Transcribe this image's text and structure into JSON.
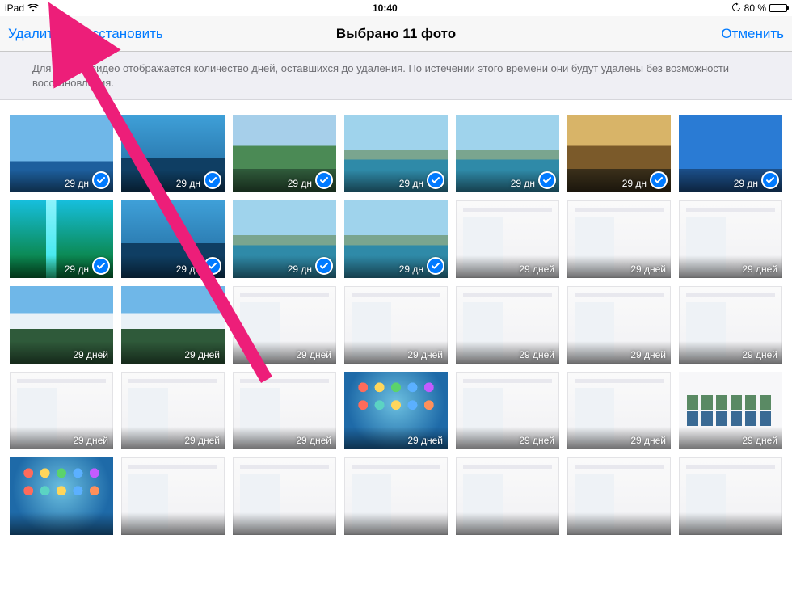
{
  "status": {
    "device": "iPad",
    "time": "10:40",
    "battery_pct": "80 %"
  },
  "nav": {
    "delete": "Удалить",
    "restore": "Восстановить",
    "title": "Выбрано 11 фото",
    "cancel": "Отменить"
  },
  "banner": "Для фото и видео отображается количество дней, оставшихся до удаления. По истечении этого времени они будут удалены без возможности восстановления.",
  "day_unit_short": "дн",
  "day_unit": "дней",
  "thumbs": [
    {
      "days": "29",
      "selected": true,
      "art": "sky-sea"
    },
    {
      "days": "29",
      "selected": true,
      "art": "pier"
    },
    {
      "days": "29",
      "selected": true,
      "art": "valley"
    },
    {
      "days": "29",
      "selected": true,
      "art": "lake-mtn"
    },
    {
      "days": "29",
      "selected": true,
      "art": "lake-mtn"
    },
    {
      "days": "29",
      "selected": true,
      "art": "autumn"
    },
    {
      "days": "29",
      "selected": true,
      "art": "tree-blue"
    },
    {
      "days": "29",
      "selected": true,
      "art": "waterfall"
    },
    {
      "days": "29",
      "selected": true,
      "art": "pier"
    },
    {
      "days": "29",
      "selected": true,
      "art": "lake-mtn"
    },
    {
      "days": "29",
      "selected": true,
      "art": "lake-mtn"
    },
    {
      "days": "29 дней",
      "selected": false,
      "art": "ui-shot"
    },
    {
      "days": "29 дней",
      "selected": false,
      "art": "ui-shot"
    },
    {
      "days": "29 дней",
      "selected": false,
      "art": "ui-shot"
    },
    {
      "days": "29 дней",
      "selected": false,
      "art": "snow-mtn"
    },
    {
      "days": "29 дней",
      "selected": false,
      "art": "snow-mtn"
    },
    {
      "days": "29 дней",
      "selected": false,
      "art": "ui-shot"
    },
    {
      "days": "29 дней",
      "selected": false,
      "art": "ui-shot"
    },
    {
      "days": "29 дней",
      "selected": false,
      "art": "ui-shot"
    },
    {
      "days": "29 дней",
      "selected": false,
      "art": "ui-shot"
    },
    {
      "days": "29 дней",
      "selected": false,
      "art": "ui-shot"
    },
    {
      "days": "29 дней",
      "selected": false,
      "art": "ui-shot"
    },
    {
      "days": "29 дней",
      "selected": false,
      "art": "ui-shot"
    },
    {
      "days": "29 дней",
      "selected": false,
      "art": "ui-shot"
    },
    {
      "days": "29 дней",
      "selected": false,
      "art": "home-scr"
    },
    {
      "days": "29 дней",
      "selected": false,
      "art": "ui-shot"
    },
    {
      "days": "29 дней",
      "selected": false,
      "art": "ui-shot"
    },
    {
      "days": "29 дней",
      "selected": false,
      "art": "thumbs-shot"
    },
    {
      "days": "",
      "selected": false,
      "art": "home-scr"
    },
    {
      "days": "",
      "selected": false,
      "art": "ui-shot"
    },
    {
      "days": "",
      "selected": false,
      "art": "ui-shot"
    },
    {
      "days": "",
      "selected": false,
      "art": "ui-shot"
    },
    {
      "days": "",
      "selected": false,
      "art": "ui-shot"
    },
    {
      "days": "",
      "selected": false,
      "art": "ui-shot"
    },
    {
      "days": "",
      "selected": false,
      "art": "ui-shot"
    }
  ]
}
